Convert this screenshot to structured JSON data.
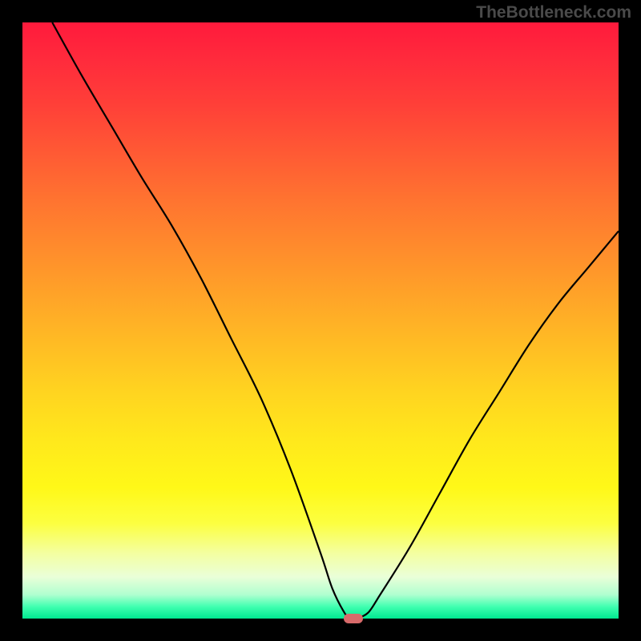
{
  "watermark": "TheBottleneck.com",
  "chart_data": {
    "type": "line",
    "title": "",
    "xlabel": "",
    "ylabel": "",
    "xlim": [
      0,
      100
    ],
    "ylim": [
      0,
      100
    ],
    "series": [
      {
        "name": "bottleneck-curve",
        "x": [
          5,
          10,
          15,
          20,
          25,
          30,
          35,
          40,
          45,
          50,
          52,
          54,
          55,
          56,
          58,
          60,
          65,
          70,
          75,
          80,
          85,
          90,
          95,
          100
        ],
        "y": [
          100,
          91,
          82.5,
          74,
          66,
          57,
          47,
          37,
          25,
          11,
          5,
          1,
          0,
          0,
          1,
          4,
          12,
          21,
          30,
          38,
          46,
          53,
          59,
          65
        ]
      }
    ],
    "marker": {
      "x": 55.5,
      "y": 0
    },
    "gradient_stops": [
      {
        "pct": 0,
        "color": "#ff1a3c"
      },
      {
        "pct": 50,
        "color": "#ffbc24"
      },
      {
        "pct": 80,
        "color": "#fff818"
      },
      {
        "pct": 100,
        "color": "#00e890"
      }
    ]
  }
}
